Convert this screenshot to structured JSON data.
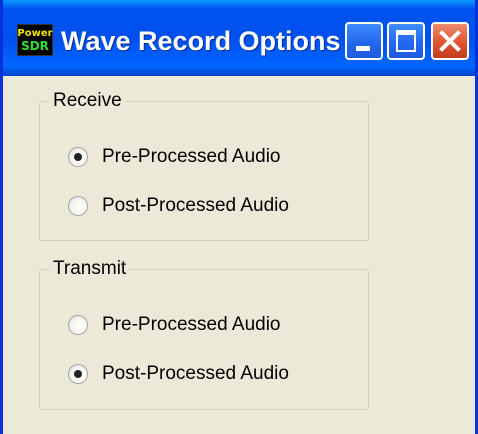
{
  "window": {
    "title": "Wave Record Options",
    "icon_name": "powersdr-icon",
    "icon_text_top": "Power",
    "icon_text_bottom": "SDR"
  },
  "titlebar_buttons": [
    "minimize",
    "maximize",
    "close"
  ],
  "groups": [
    {
      "label": "Receive",
      "options": [
        {
          "label": "Pre-Processed Audio",
          "selected": true
        },
        {
          "label": "Post-Processed Audio",
          "selected": false
        }
      ]
    },
    {
      "label": "Transmit",
      "options": [
        {
          "label": "Pre-Processed Audio",
          "selected": false
        },
        {
          "label": "Post-Processed Audio",
          "selected": true
        }
      ]
    }
  ],
  "colors": {
    "window_bg": "#ECE9D8",
    "titlebar": "#0053EE",
    "close_button": "#E0532E"
  }
}
